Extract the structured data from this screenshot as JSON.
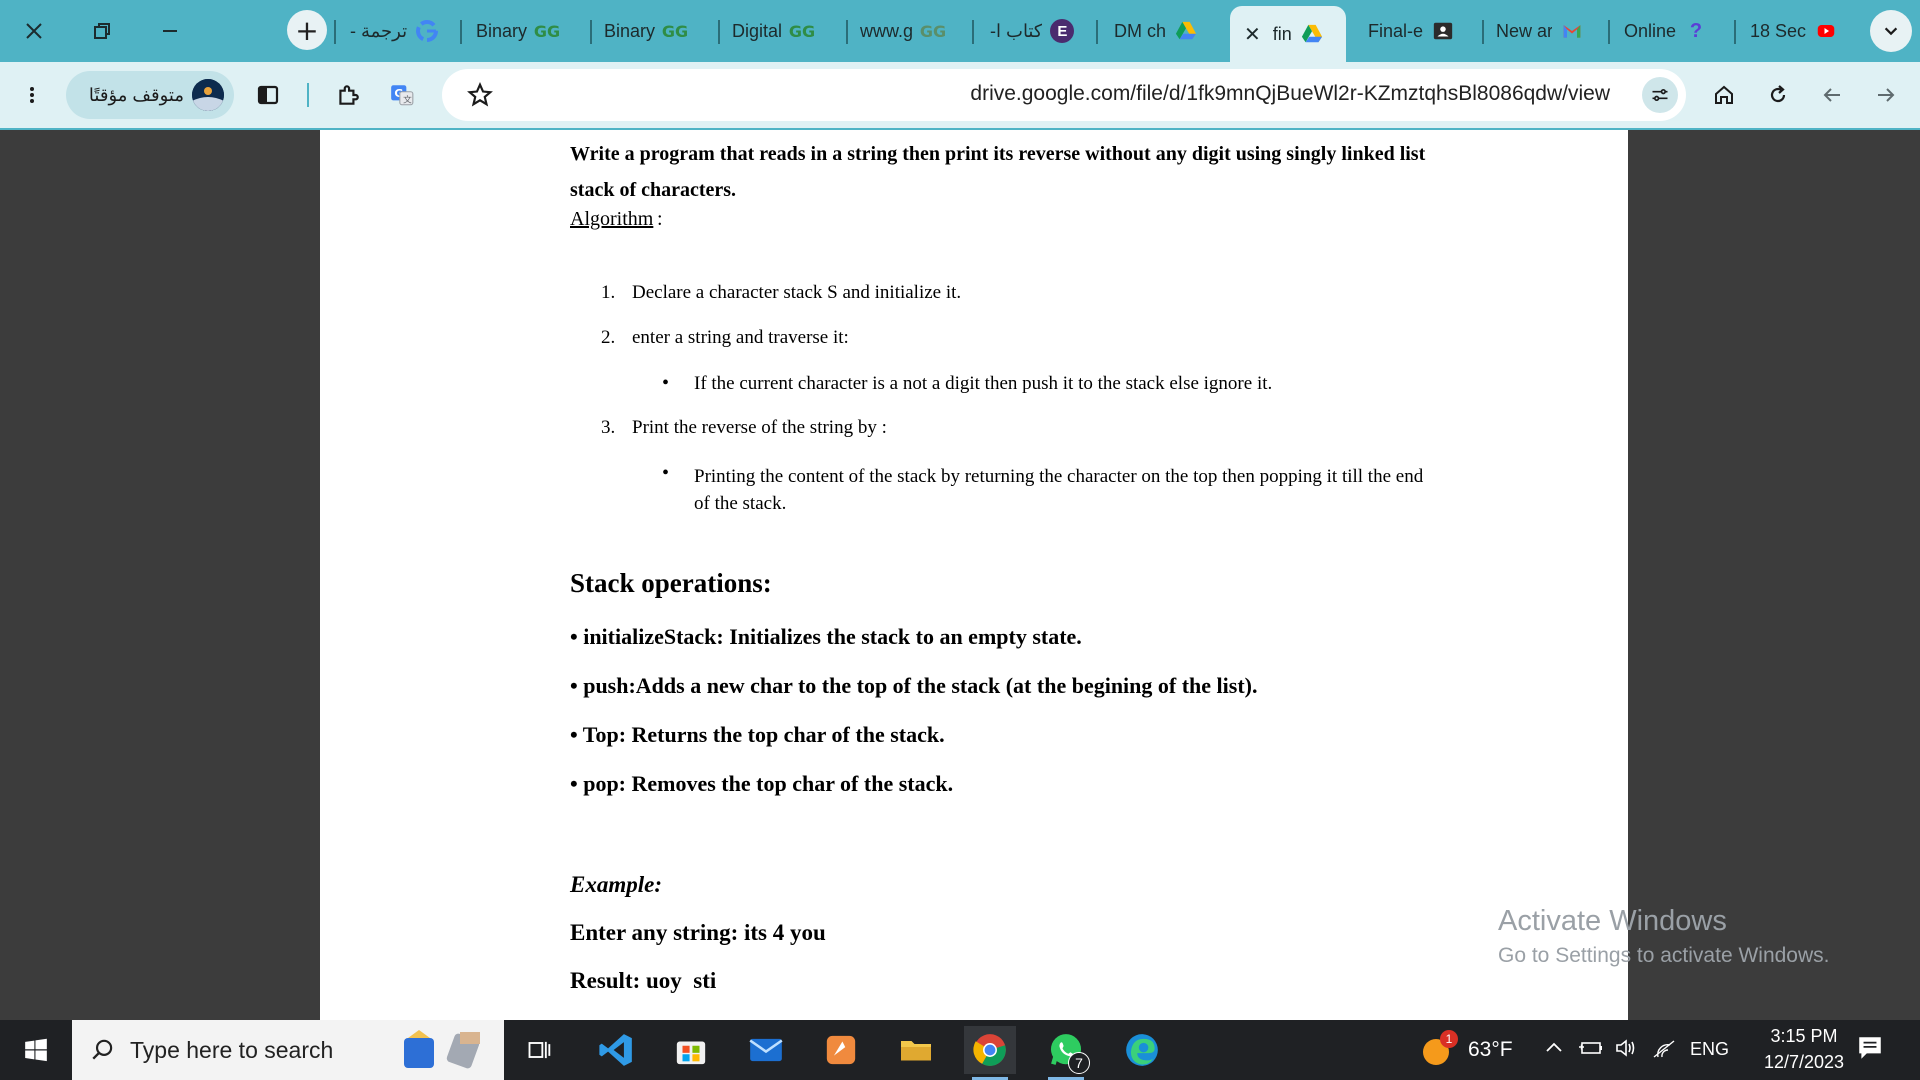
{
  "browser": {
    "tabs": [
      {
        "title": "ترجمة -",
        "icon": "google-icon"
      },
      {
        "title": "Binary",
        "icon": "geeksforgeeks-icon"
      },
      {
        "title": "Binary",
        "icon": "geeksforgeeks-icon"
      },
      {
        "title": "Digital",
        "icon": "geeksforgeeks-icon"
      },
      {
        "title": "www.g",
        "icon": "geeksforgeeks-icon"
      },
      {
        "title": "كتاب ا-",
        "icon": "e-letter-icon"
      },
      {
        "title": "DM ch",
        "icon": "google-drive-icon"
      },
      {
        "title": "fin",
        "icon": "google-drive-icon",
        "active": true
      },
      {
        "title": "Final-e",
        "icon": "contact-icon"
      },
      {
        "title": "New ar",
        "icon": "gmail-icon"
      },
      {
        "title": "Online",
        "icon": "question-mark-icon"
      },
      {
        "title": "18 Sec",
        "icon": "youtube-icon"
      }
    ],
    "profile_label": "متوقف مؤقتًا",
    "url": "drive.google.com/file/d/1fk9mnQjBueWl2r-KZmztqhsBl8086qdw/view"
  },
  "document": {
    "question": "Write a program that reads in a string then print its reverse without any digit using singly linked list stack of characters.",
    "algorithm_heading": "Algorithm",
    "algorithm_colon": ":",
    "steps": [
      {
        "num": "1.",
        "text": "Declare a character stack S and initialize it."
      },
      {
        "num": "2.",
        "text": "enter a string and traverse it:"
      },
      {
        "num": "3.",
        "text": "Print the reverse of the string by :"
      }
    ],
    "step2_bullet": "If the current character is a not a digit then push it to the stack else ignore it.",
    "step3_bullet": "Printing the content of the stack by returning the character on the top then popping it till the end of the stack.",
    "bullet_char": "•",
    "stack_ops_title": "Stack operations:",
    "ops": [
      "• initializeStack: Initializes the stack to an empty state.",
      "• push:Adds a new char to the top of the stack (at the begining of the list).",
      "• Top: Returns the top char of the stack.",
      "• pop: Removes the top char of the stack."
    ],
    "example_title": "Example:",
    "example_input": "Enter any string: its 4 you",
    "example_result": "Result: uoy  sti"
  },
  "watermark": {
    "line1": "Activate Windows",
    "line2": "Go to Settings to activate Windows."
  },
  "taskbar": {
    "search_placeholder": "Type here to search",
    "apps": [
      "task-view-icon",
      "vscode-icon",
      "microsoft-store-icon",
      "mail-icon",
      "slides-app-icon",
      "file-explorer-icon",
      "chrome-icon",
      "whatsapp-icon",
      "edge-icon"
    ],
    "whatsapp_badge": "7",
    "weather_badge": "1",
    "temperature": "63°F",
    "language": "ENG",
    "time": "3:15 PM",
    "date": "12/7/2023"
  }
}
